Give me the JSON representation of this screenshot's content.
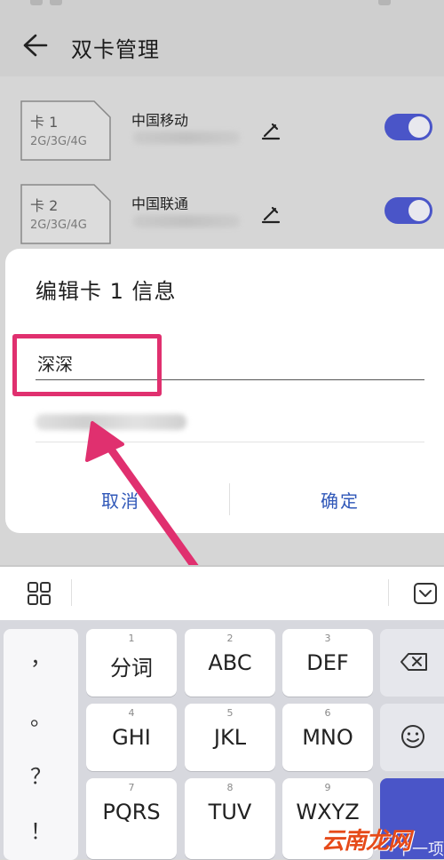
{
  "header": {
    "title": "双卡管理"
  },
  "sims": [
    {
      "slot": "卡 1",
      "bands": "2G/3G/4G",
      "carrier": "中国移动",
      "number": "",
      "enabled": true
    },
    {
      "slot": "卡 2",
      "bands": "2G/3G/4G",
      "carrier": "中国联通",
      "number": "",
      "enabled": true
    }
  ],
  "dialog": {
    "title": "编辑卡 1 信息",
    "name_value": "深深",
    "cancel_label": "取消",
    "confirm_label": "确定"
  },
  "keyboard": {
    "punctuation": [
      "，",
      "。",
      "？",
      "！"
    ],
    "keys": [
      {
        "num": "1",
        "label": "分词"
      },
      {
        "num": "2",
        "label": "ABC"
      },
      {
        "num": "3",
        "label": "DEF"
      },
      {
        "num": "4",
        "label": "GHI"
      },
      {
        "num": "5",
        "label": "JKL"
      },
      {
        "num": "6",
        "label": "MNO"
      },
      {
        "num": "7",
        "label": "PQRS"
      },
      {
        "num": "8",
        "label": "TUV"
      },
      {
        "num": "9",
        "label": "WXYZ"
      }
    ],
    "next_label": "下一项"
  },
  "watermark": "云南龙网",
  "colors": {
    "accent": "#4a55c8",
    "highlight": "#e0306f",
    "link": "#2f57b8"
  }
}
